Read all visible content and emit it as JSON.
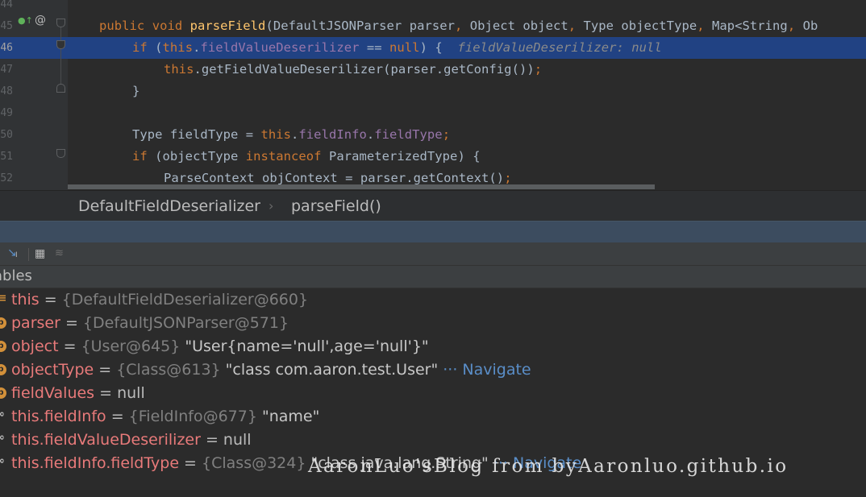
{
  "editor": {
    "lines": [
      {
        "num": "44",
        "text": "",
        "highlighted": false
      },
      {
        "num": "45",
        "highlighted": false,
        "tokens": [
          {
            "t": "public ",
            "c": "kw"
          },
          {
            "t": "void ",
            "c": "kw"
          },
          {
            "t": "parseField",
            "c": "fn"
          },
          {
            "t": "(DefaultJSONParser parser",
            "c": ""
          },
          {
            "t": ", ",
            "c": "kw"
          },
          {
            "t": "Object object",
            "c": ""
          },
          {
            "t": ", ",
            "c": "kw"
          },
          {
            "t": "Type objectType",
            "c": ""
          },
          {
            "t": ", ",
            "c": "kw"
          },
          {
            "t": "Map<String",
            "c": ""
          },
          {
            "t": ", ",
            "c": "kw"
          },
          {
            "t": "Ob",
            "c": ""
          }
        ]
      },
      {
        "num": "46",
        "highlighted": true,
        "tokens": [
          {
            "t": "if ",
            "c": "kw"
          },
          {
            "t": "(",
            "c": ""
          },
          {
            "t": "this",
            "c": "kw"
          },
          {
            "t": ".",
            "c": ""
          },
          {
            "t": "fieldValueDeserilizer",
            "c": "fld"
          },
          {
            "t": " == ",
            "c": ""
          },
          {
            "t": "null",
            "c": "kw"
          },
          {
            "t": ") {  ",
            "c": ""
          },
          {
            "t": "fieldValueDeserilizer: null",
            "c": "inl"
          }
        ]
      },
      {
        "num": "47",
        "highlighted": false,
        "tokens": [
          {
            "t": "this",
            "c": "kw"
          },
          {
            "t": ".getFieldValueDeserilizer(parser.getConfig())",
            "c": ""
          },
          {
            "t": ";",
            "c": "kw"
          }
        ]
      },
      {
        "num": "48",
        "highlighted": false,
        "tokens": [
          {
            "t": "}",
            "c": ""
          }
        ]
      },
      {
        "num": "49",
        "highlighted": false,
        "tokens": []
      },
      {
        "num": "50",
        "highlighted": false,
        "tokens": [
          {
            "t": "Type fieldType = ",
            "c": ""
          },
          {
            "t": "this",
            "c": "kw"
          },
          {
            "t": ".",
            "c": ""
          },
          {
            "t": "fieldInfo",
            "c": "fld"
          },
          {
            "t": ".",
            "c": ""
          },
          {
            "t": "fieldType",
            "c": "fld"
          },
          {
            "t": ";",
            "c": "kw"
          }
        ]
      },
      {
        "num": "51",
        "highlighted": false,
        "tokens": [
          {
            "t": "if ",
            "c": "kw"
          },
          {
            "t": "(objectType ",
            "c": ""
          },
          {
            "t": "instanceof ",
            "c": "kw"
          },
          {
            "t": "ParameterizedType) {",
            "c": ""
          }
        ]
      },
      {
        "num": "52",
        "highlighted": false,
        "tokens": [
          {
            "t": "ParseContext objContext = parser.getContext()",
            "c": ""
          },
          {
            "t": ";",
            "c": "kw"
          }
        ]
      }
    ]
  },
  "breadcrumb": {
    "class_name": "DefaultFieldDeserializer",
    "separator": "›",
    "method_name": "parseField()"
  },
  "variables": {
    "title": "ables",
    "rows": [
      {
        "icon": "lines",
        "name": "this",
        "eq": " = ",
        "ref": "{DefaultFieldDeserializer@660}",
        "value": "",
        "nav": ""
      },
      {
        "icon": "p",
        "name": "parser",
        "eq": " = ",
        "ref": "{DefaultJSONParser@571}",
        "value": "",
        "nav": ""
      },
      {
        "icon": "p",
        "name": "object",
        "eq": " = ",
        "ref": "{User@645}",
        "value": " \"User{name='null',age='null'}\"",
        "nav": ""
      },
      {
        "icon": "p",
        "name": "objectType",
        "eq": " = ",
        "ref": "{Class@613}",
        "value": " \"class com.aaron.test.User\"",
        "nav": " ··· Navigate"
      },
      {
        "icon": "p",
        "name": "fieldValues",
        "eq": " = null",
        "ref": "",
        "value": "",
        "nav": ""
      },
      {
        "icon": "glass",
        "name": "this.fieldInfo",
        "eq": " = ",
        "ref": "{FieldInfo@677}",
        "value": " \"name\"",
        "nav": ""
      },
      {
        "icon": "glass",
        "name": "this.fieldValueDeserilizer",
        "eq": " = null",
        "ref": "",
        "value": "",
        "nav": ""
      },
      {
        "icon": "glass",
        "name": "this.fieldInfo.fieldType",
        "eq": " = ",
        "ref": "{Class@324}",
        "value": " \"class java.lang.String\"",
        "nav": " ··· Navigate"
      }
    ]
  },
  "watermark": "AaronLuo'sBlog from byAaronluo.github.io",
  "colors": {
    "editor_bg": "#2b2b2b",
    "highlight": "#214283",
    "keyword": "#cc7832",
    "field": "#9876aa",
    "method": "#ffc66d",
    "var_name": "#e87a7a"
  }
}
